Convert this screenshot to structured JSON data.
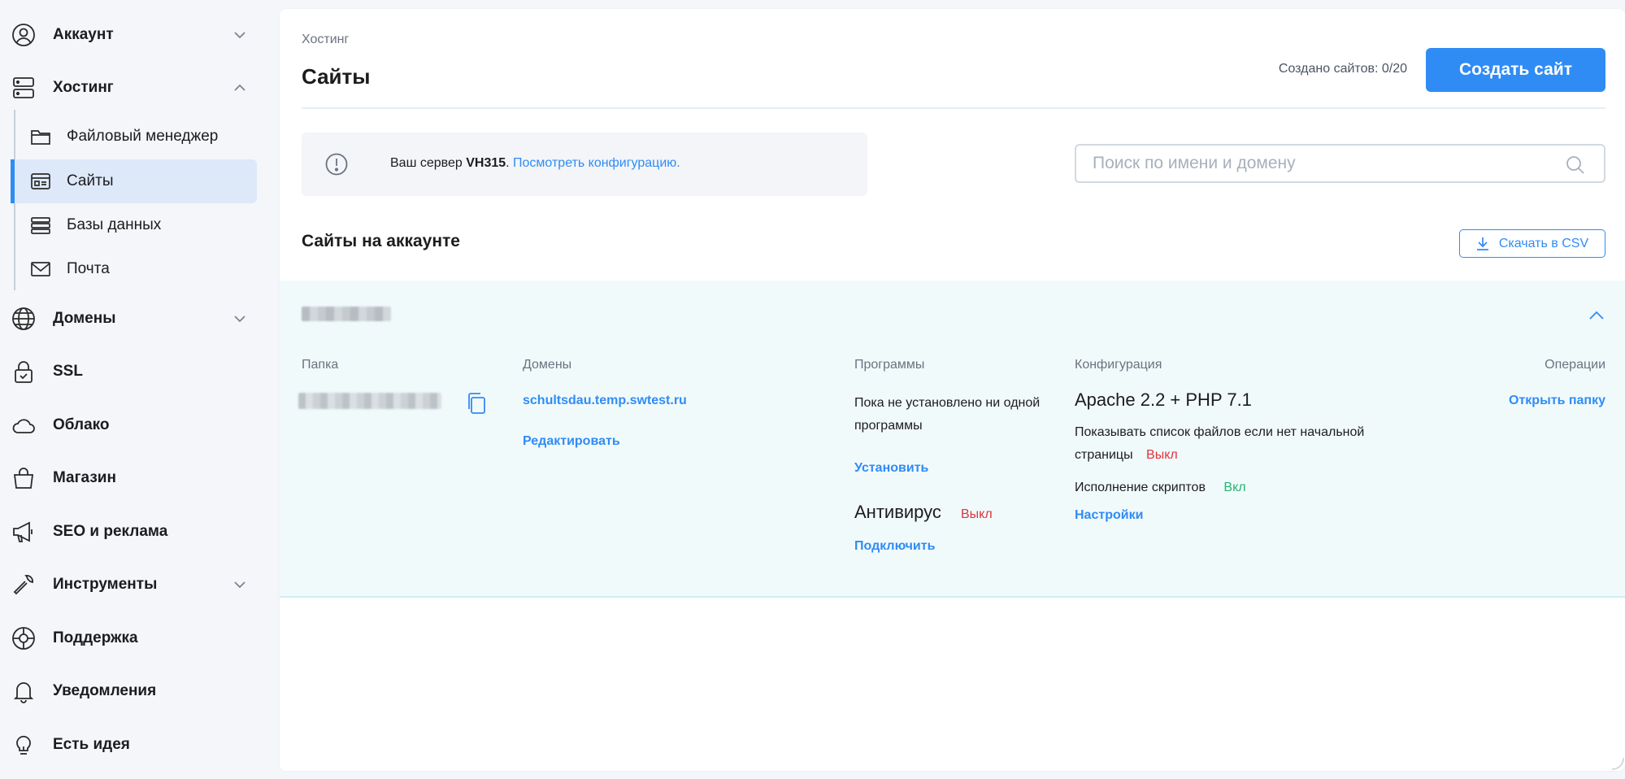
{
  "sidebar": {
    "items": [
      {
        "label": "Аккаунт",
        "icon": "user-circle-icon"
      },
      {
        "label": "Хостинг",
        "icon": "server-icon"
      },
      {
        "label": "Домены",
        "icon": "globe-icon"
      },
      {
        "label": "SSL",
        "icon": "lock-icon"
      },
      {
        "label": "Облако",
        "icon": "cloud-icon"
      },
      {
        "label": "Магазин",
        "icon": "shopping-bag-icon"
      },
      {
        "label": "SEO и реклама",
        "icon": "megaphone-icon"
      },
      {
        "label": "Инструменты",
        "icon": "wrench-icon"
      },
      {
        "label": "Поддержка",
        "icon": "lifebuoy-icon"
      },
      {
        "label": "Уведомления",
        "icon": "bell-icon"
      },
      {
        "label": "Есть идея",
        "icon": "lightbulb-icon"
      }
    ],
    "hosting_sub": [
      {
        "label": "Файловый менеджер",
        "icon": "folder-icon"
      },
      {
        "label": "Сайты",
        "icon": "site-card-icon",
        "active": true
      },
      {
        "label": "Базы данных",
        "icon": "database-icon"
      },
      {
        "label": "Почта",
        "icon": "mail-icon"
      }
    ]
  },
  "header": {
    "breadcrumb": "Хостинг",
    "title": "Сайты",
    "sites_created": "Создано сайтов: 0/20",
    "create_button": "Создать сайт"
  },
  "notice": {
    "prefix": "Ваш сервер ",
    "server": "VH315",
    "dot": ". ",
    "link": "Посмотреть конфигурацию."
  },
  "search": {
    "placeholder": "Поиск по имени и домену",
    "value": ""
  },
  "sites_section": {
    "title": "Сайты на аккаунте",
    "csv_button": "Скачать в CSV"
  },
  "site": {
    "columns": {
      "folder": "Папка",
      "domains": "Домены",
      "programs": "Программы",
      "config": "Конфигурация",
      "operations": "Операции"
    },
    "domain": "schultsdau.temp.swtest.ru",
    "edit_link": "Редактировать",
    "no_programs": "Пока не установлено ни одной программы",
    "install_link": "Установить",
    "antivirus_label": "Антивирус",
    "antivirus_status": "Выкл",
    "connect_link": "Подключить",
    "config_title": "Apache 2.2 + PHP 7.1",
    "show_files_label": "Показывать список файлов если нет начальной страницы",
    "show_files_status": "Выкл",
    "scripts_label": "Исполнение скриптов",
    "scripts_status": "Вкл",
    "settings_link": "Настройки",
    "open_folder_link": "Открыть папку"
  },
  "colors": {
    "accent": "#2f8cf5",
    "off": "#e0323e",
    "on": "#22b573",
    "active_bg": "#dde9f9",
    "site_bg": "#f1fafb"
  }
}
